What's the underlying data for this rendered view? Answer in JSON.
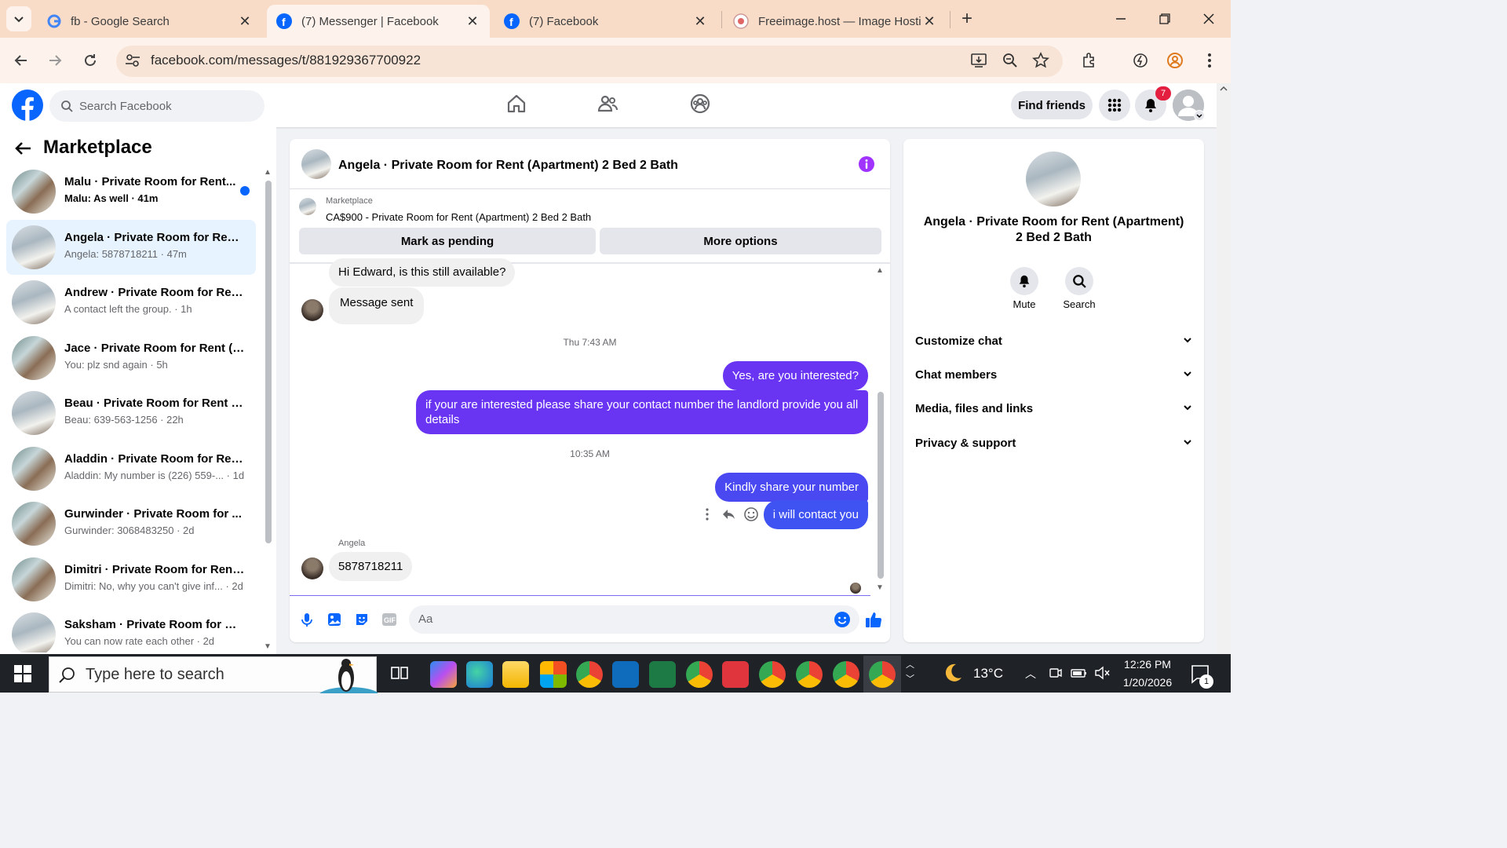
{
  "browser": {
    "tabs": [
      {
        "title": "fb - Google Search",
        "icon": "google-icon"
      },
      {
        "title": "(7) Messenger | Facebook",
        "icon": "facebook-icon"
      },
      {
        "title": "(7) Facebook",
        "icon": "facebook-icon"
      },
      {
        "title": "Freeimage.host — Image Hostir",
        "icon": "freeimage-icon"
      }
    ],
    "url": "facebook.com/messages/t/881929367700922"
  },
  "header": {
    "search_placeholder": "Search Facebook",
    "find_friends": "Find friends",
    "notification_count": "7"
  },
  "sidebar": {
    "title": "Marketplace",
    "conversations": [
      {
        "name": "Malu · Private Room for Rent...",
        "preview": "Malu: As well · 41m",
        "unread": true
      },
      {
        "name": "Angela · Private Room for Rent...",
        "preview": "Angela: 5878718211 · 47m",
        "selected": true
      },
      {
        "name": "Andrew · Private Room for Ren...",
        "preview": "A contact left the group. · 1h"
      },
      {
        "name": "Jace · Private Room for Rent (A...",
        "preview": "You: plz snd again · 5h"
      },
      {
        "name": "Beau · Private Room for Rent (...",
        "preview": "Beau: 639-563-1256 · 22h"
      },
      {
        "name": "Aladdin · Private Room for Ren...",
        "preview": "Aladdin: My number is (226) 559-... · 1d"
      },
      {
        "name": "Gurwinder · Private Room for ...",
        "preview": "Gurwinder: 3068483250 · 2d"
      },
      {
        "name": "Dimitri · Private Room for Rent...",
        "preview": "Dimitri: No, why you can't give inf... · 2d"
      },
      {
        "name": "Saksham · Private Room for Re...",
        "preview": "You can now rate each other · 2d"
      }
    ]
  },
  "chat": {
    "title": "Angela · Private Room for Rent (Apartment) 2 Bed 2 Bath",
    "listing_label": "Marketplace",
    "listing_text": "CA$900 - Private Room for Rent (Apartment) 2 Bed 2 Bath",
    "mark_pending": "Mark as pending",
    "more_options": "More options",
    "messages": [
      {
        "text": "Hi Edward, is this still available?",
        "dir": "in"
      },
      {
        "text": "Message sent",
        "dir": "in"
      },
      {
        "stamp": "Thu 7:43 AM"
      },
      {
        "text": "Yes, are you interested?",
        "dir": "out"
      },
      {
        "text": "if your are interested please share your contact number the landlord provide you all details",
        "dir": "out"
      },
      {
        "stamp": "10:35 AM"
      },
      {
        "text": "Kindly share your number",
        "dir": "out"
      },
      {
        "text": "i will contact you",
        "dir": "out"
      },
      {
        "sender": "Angela"
      },
      {
        "text": "5878718211",
        "dir": "in"
      }
    ],
    "composer_placeholder": "Aa"
  },
  "details": {
    "title": "Angela · Private Room for Rent (Apartment) 2 Bed 2 Bath",
    "mute": "Mute",
    "search": "Search",
    "sections": [
      "Customize chat",
      "Chat members",
      "Media, files and links",
      "Privacy & support"
    ]
  },
  "taskbar": {
    "search_placeholder": "Type here to search",
    "temperature": "13°C",
    "time": "12:26 PM",
    "date": "1/20/2026",
    "notifications": "1"
  },
  "colors": {
    "fb_blue": "#0866ff",
    "bubble_out_top": "#5b3df5",
    "bubble_out_bottom": "#7a2bf0",
    "accent_purple": "#a033ff"
  }
}
